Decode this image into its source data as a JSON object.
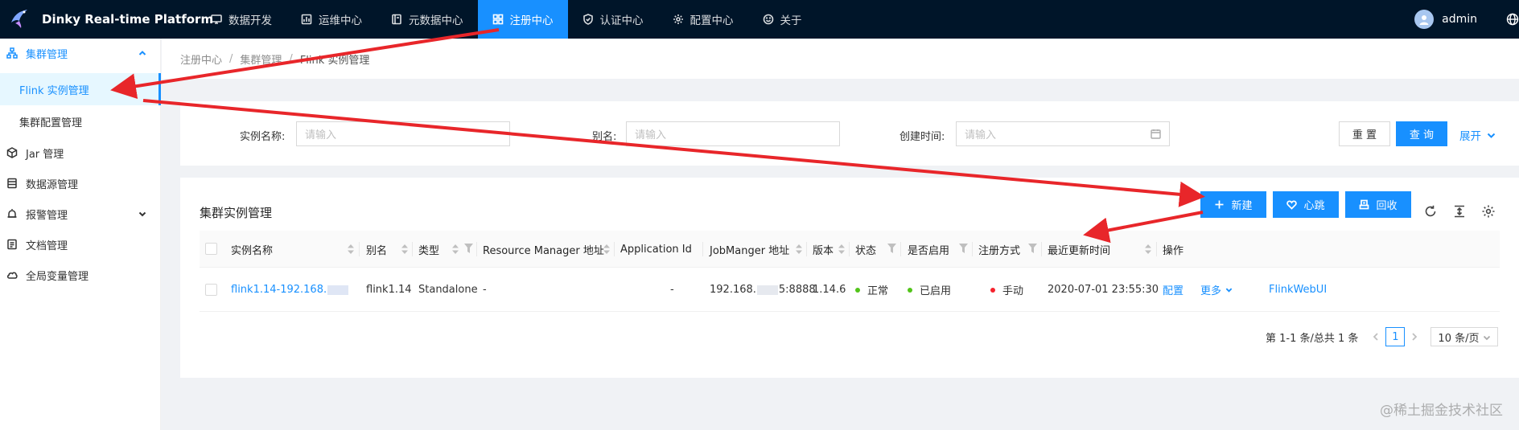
{
  "app": {
    "title": "Dinky Real-time Platform"
  },
  "topnav": [
    {
      "label": "数据开发",
      "icon": "monitor-icon"
    },
    {
      "label": "运维中心",
      "icon": "dashboard-icon"
    },
    {
      "label": "元数据中心",
      "icon": "book-icon"
    },
    {
      "label": "注册中心",
      "icon": "appstore-icon",
      "active": true
    },
    {
      "label": "认证中心",
      "icon": "safety-icon"
    },
    {
      "label": "配置中心",
      "icon": "setting-icon"
    },
    {
      "label": "关于",
      "icon": "smile-icon"
    }
  ],
  "user": {
    "name": "admin"
  },
  "sidebar": {
    "items": [
      {
        "label": "集群管理",
        "icon": "cluster-icon"
      },
      {
        "label": "Flink 实例管理"
      },
      {
        "label": "集群配置管理"
      },
      {
        "label": "Jar 管理",
        "icon": "code-sandbox-icon"
      },
      {
        "label": "数据源管理",
        "icon": "database-icon"
      },
      {
        "label": "报警管理",
        "icon": "alert-icon"
      },
      {
        "label": "文档管理",
        "icon": "file-icon"
      },
      {
        "label": "全局变量管理",
        "icon": "cloud-icon"
      }
    ]
  },
  "breadcrumb": [
    "注册中心",
    "集群管理",
    "Flink 实例管理"
  ],
  "search": {
    "name_label": "实例名称:",
    "name_placeholder": "请输入",
    "alias_label": "别名:",
    "alias_placeholder": "请输入",
    "created_label": "创建时间:",
    "created_placeholder": "请输入",
    "reset_label": "重 置",
    "query_label": "查 询",
    "expand_label": "展开"
  },
  "table": {
    "title": "集群实例管理",
    "new_label": "新建",
    "heartbeat_label": "心跳",
    "recycle_label": "回收",
    "columns": [
      "实例名称",
      "别名",
      "类型",
      "Resource Manager 地址",
      "Application Id",
      "JobManger 地址",
      "版本",
      "状态",
      "是否启用",
      "注册方式",
      "最近更新时间",
      "操作"
    ],
    "rows": [
      {
        "name": "flink1.14-192.168.",
        "alias": "flink1.14",
        "type": "Standalone",
        "rm_address": "-",
        "app_id": "-",
        "jm_prefix": "192.168.",
        "jm_suffix": "5:8888",
        "version": "1.14.6",
        "status": "正常",
        "enabled": "已启用",
        "register": "手动",
        "updated": "2020-07-01 23:55:30",
        "action_config": "配置",
        "action_more": "更多",
        "action_webui": "FlinkWebUI"
      }
    ],
    "pagination": {
      "summary": "第 1-1 条/总共 1 条",
      "current": "1",
      "page_size": "10 条/页"
    }
  },
  "colors": {
    "header_bg": "#001529",
    "primary": "#1890ff",
    "status_ok": "#52c41a",
    "status_manual": "#f5222d",
    "arrow": "#e8262a"
  },
  "watermark": "@稀土掘金技术社区"
}
